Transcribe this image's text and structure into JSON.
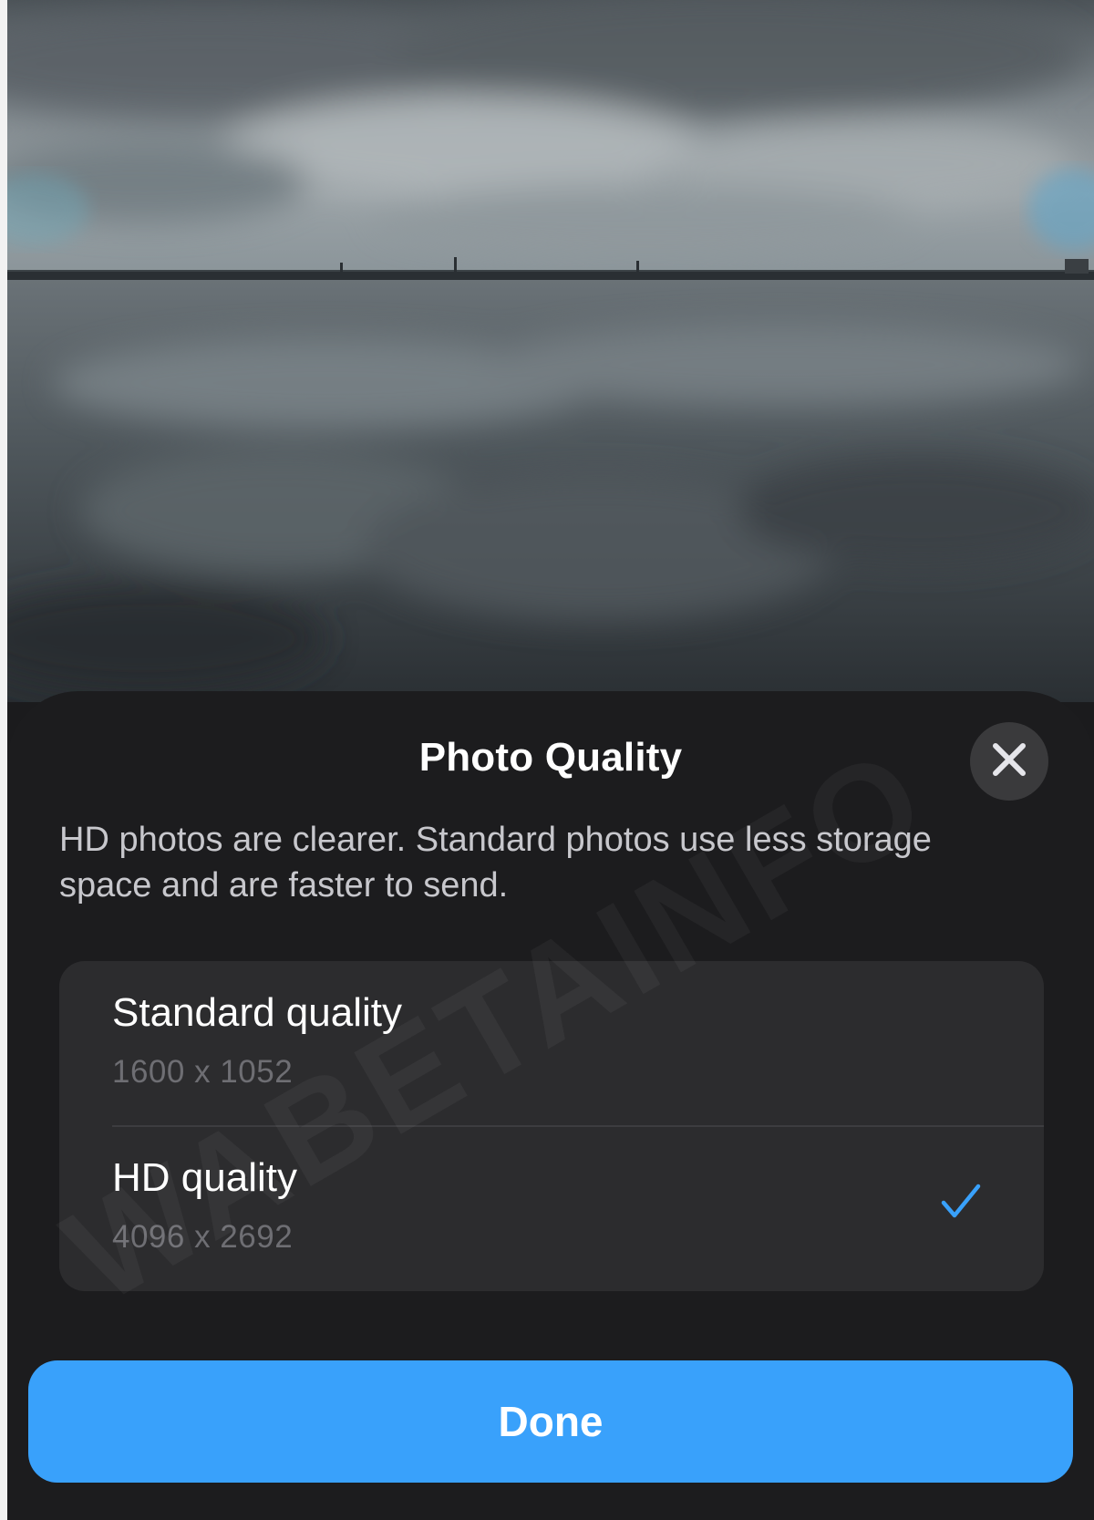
{
  "sheet": {
    "title": "Photo Quality",
    "close_icon": "close-icon",
    "description": "HD photos are clearer. Standard photos use less storage space and are faster to send."
  },
  "options": [
    {
      "label": "Standard quality",
      "resolution": "1600 x 1052",
      "selected": false
    },
    {
      "label": "HD quality",
      "resolution": "4096 x 2692",
      "selected": true
    }
  ],
  "selected_icon": "checkmark-icon",
  "done_label": "Done",
  "watermark": "WABETAINFO",
  "colors": {
    "sheet_background": "#1c1c1e",
    "options_background": "#2c2c2e",
    "accent": "#39a1fb",
    "secondary_text": "#6e6e73"
  }
}
